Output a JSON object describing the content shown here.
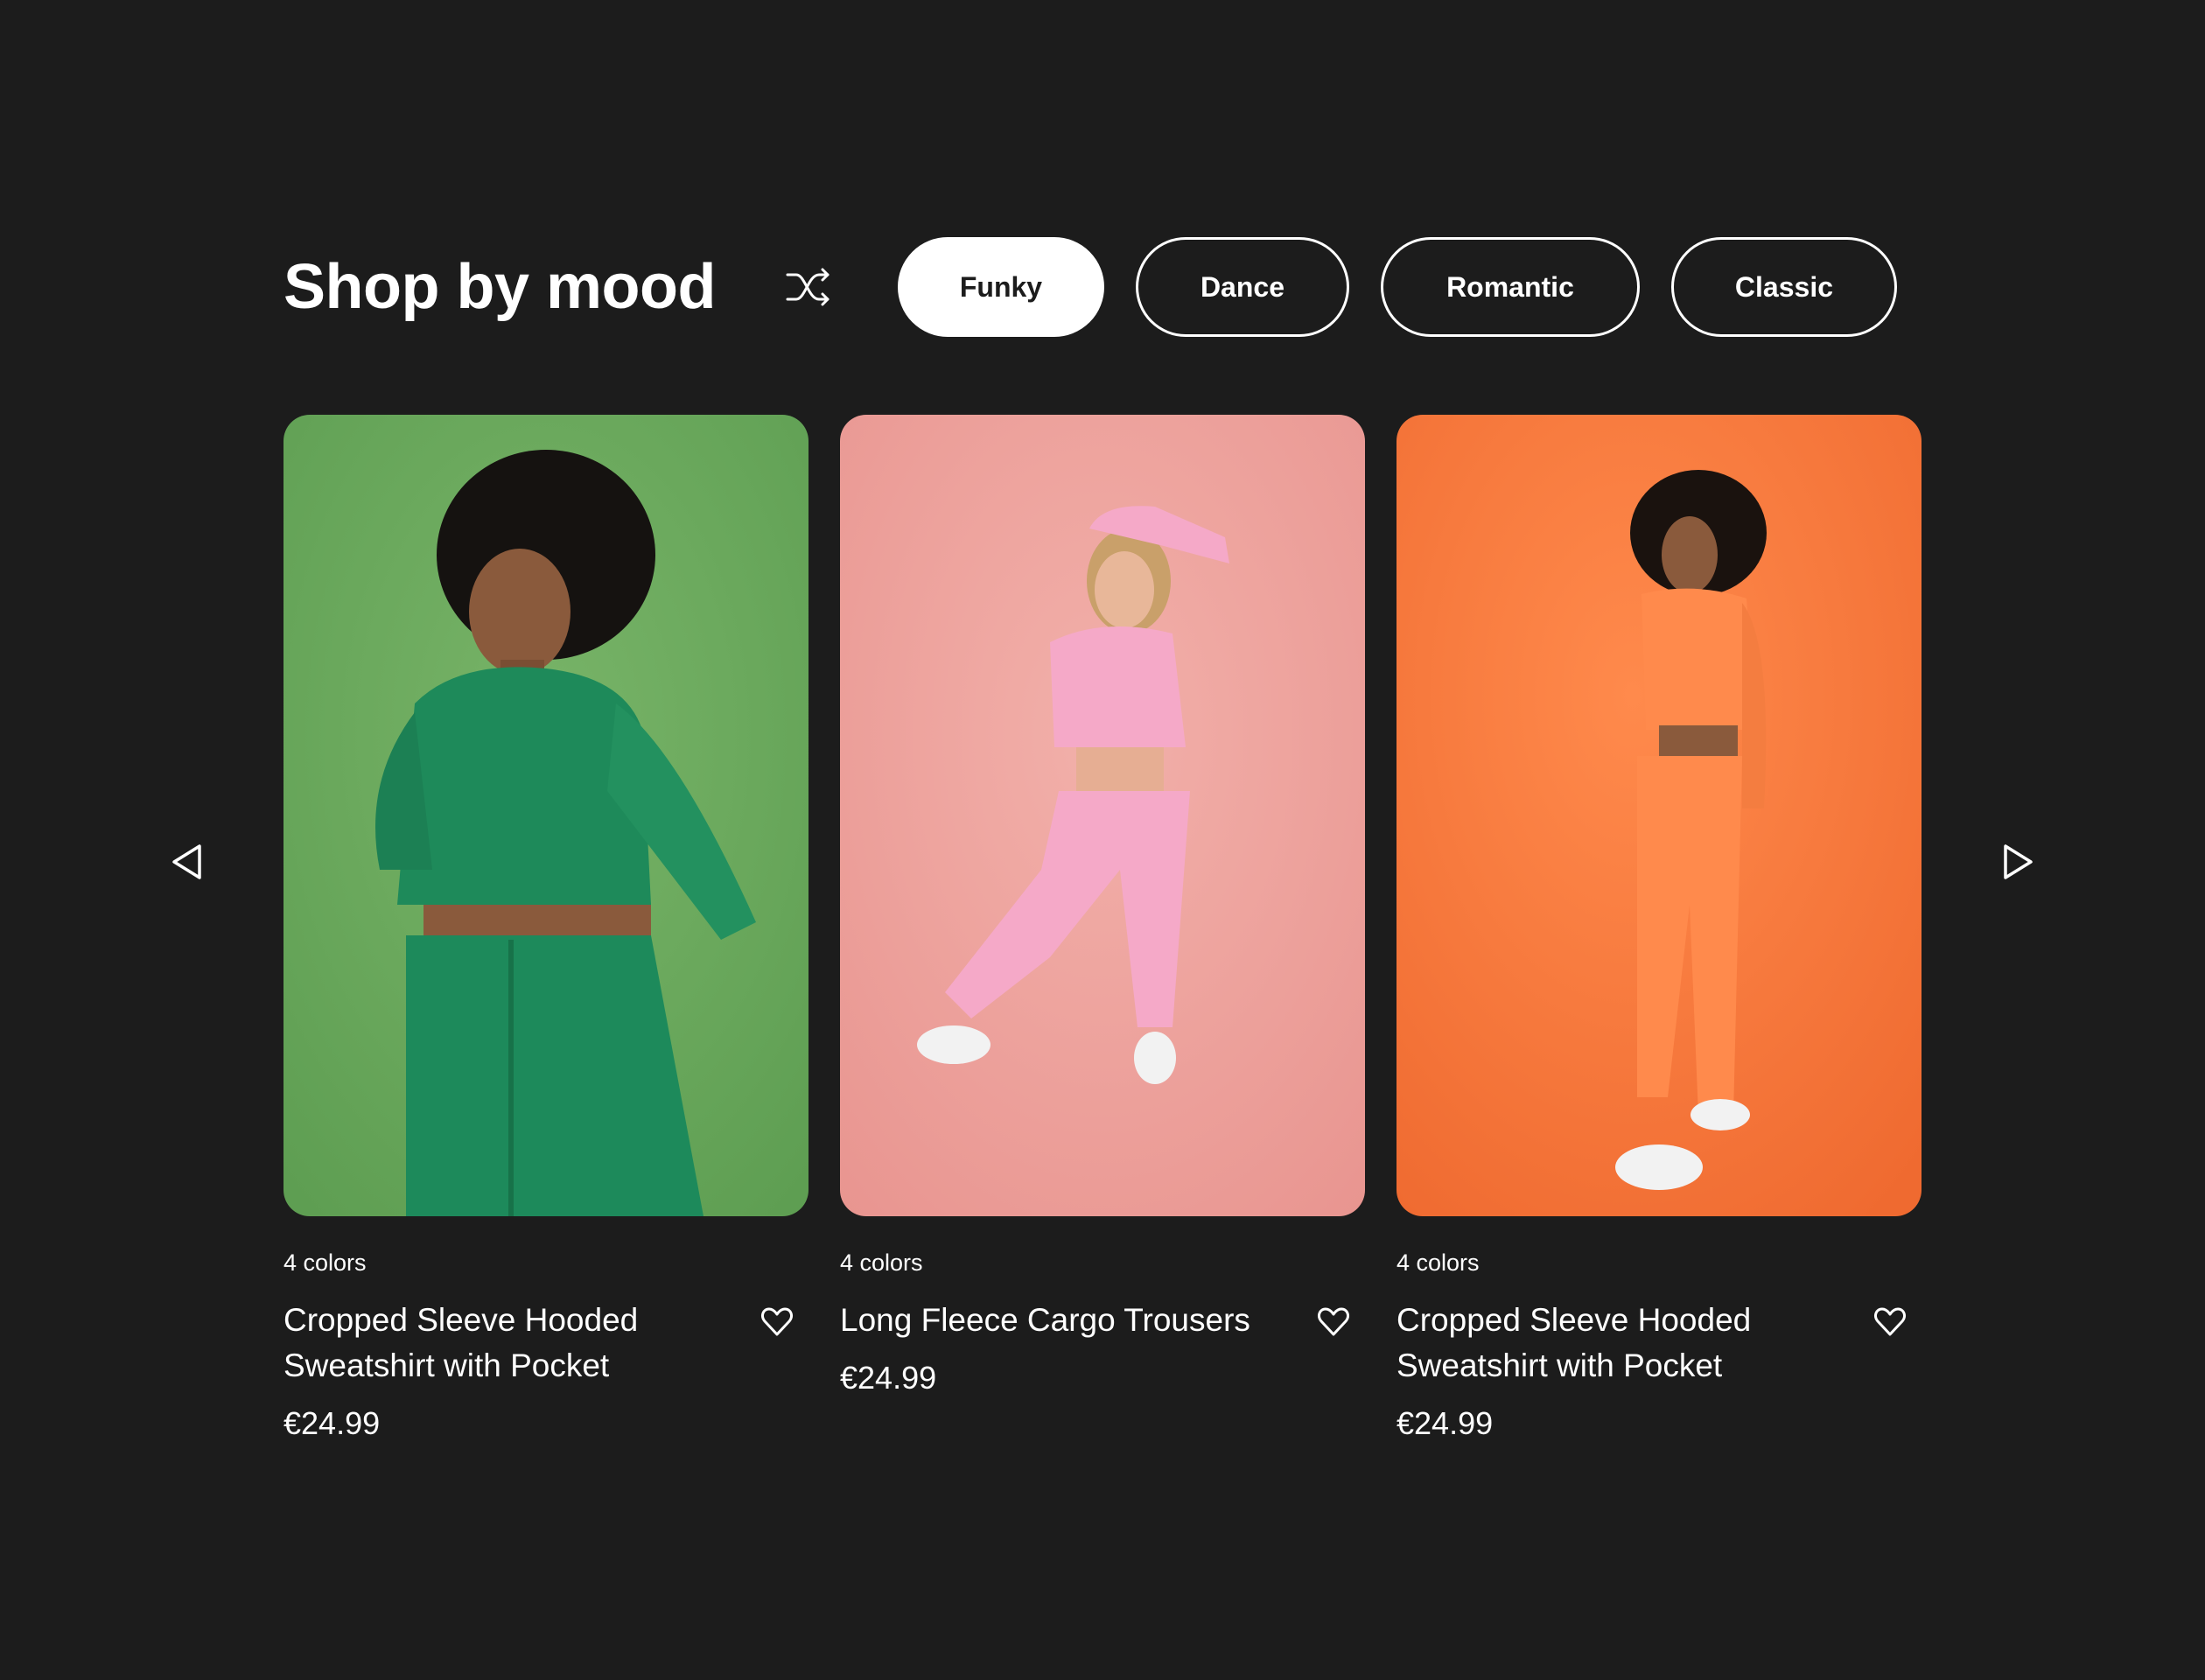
{
  "header": {
    "title": "Shop by mood",
    "shuffle_icon": "shuffle-icon"
  },
  "moods": [
    {
      "label": "Funky",
      "active": true
    },
    {
      "label": "Dance",
      "active": false
    },
    {
      "label": "Romantic",
      "active": false
    },
    {
      "label": "Classic",
      "active": false
    }
  ],
  "carousel": {
    "prev_icon": "triangle-left-icon",
    "next_icon": "triangle-right-icon"
  },
  "products": [
    {
      "colors": "4 colors",
      "name": "Cropped Sleeve Hooded Sweatshirt with Pocket",
      "price": "€24.99",
      "background_color": "#6aa85c",
      "outfit_color": "#1f8a5c",
      "wishlist_icon": "heart-icon"
    },
    {
      "colors": "4 colors",
      "name": "Long Fleece Cargo Trousers",
      "price": "€24.99",
      "background_color": "#eea49f",
      "outfit_color": "#f5a9c8",
      "wishlist_icon": "heart-icon"
    },
    {
      "colors": "4 colors",
      "name": "Cropped Sleeve Hooded Sweatshirt with Pocket",
      "price": "€24.99",
      "background_color": "#fb7a3e",
      "outfit_color": "#ff8a4c",
      "wishlist_icon": "heart-icon"
    }
  ],
  "colors": {
    "page_background": "#1c1c1c",
    "text": "#ffffff",
    "active_chip_background": "#ffffff",
    "active_chip_text": "#1c1c1c"
  }
}
